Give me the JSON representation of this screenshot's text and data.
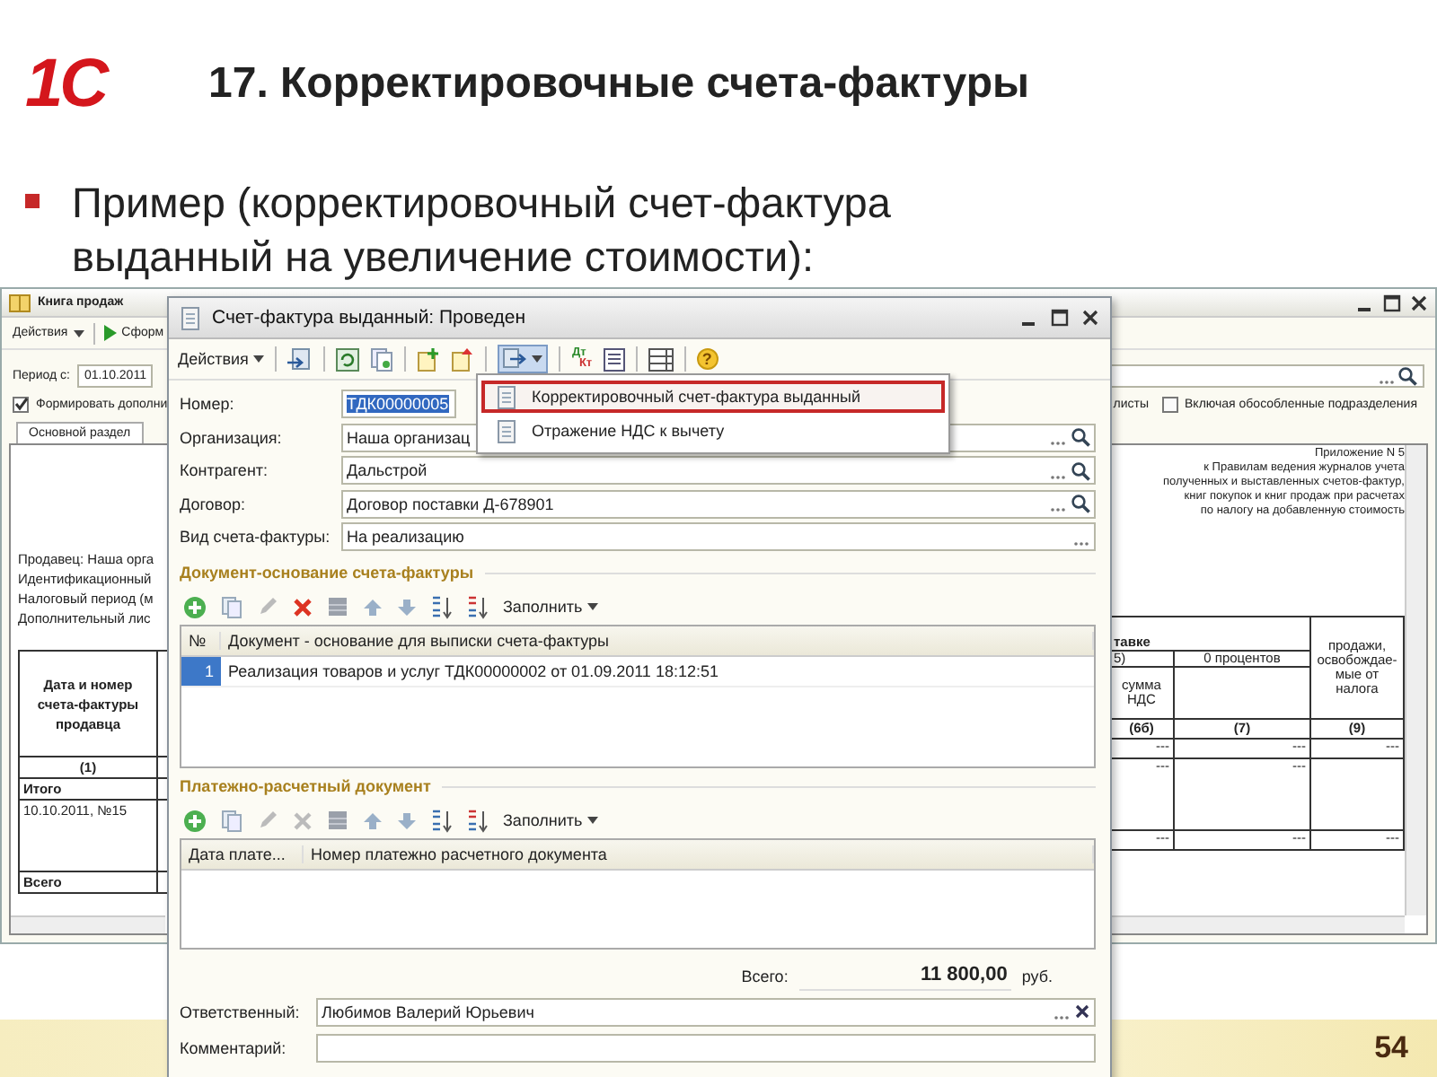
{
  "slide": {
    "logo": "1С",
    "title": "17. Корректировочные счета-фактуры",
    "bullet": "Пример (корректировочный счет-фактура выданный на увеличение стоимости):",
    "page_number": "54"
  },
  "book_window": {
    "title": "Книга продаж",
    "actions": "Действия",
    "generate": "Сформ",
    "period_label": "Период с:",
    "period_value": "01.10.2011",
    "options": [
      {
        "label": "Формировать дополни",
        "checked": true
      },
      {
        "label": "Включая обособленные подразделения",
        "checked": false
      }
    ],
    "sheets_label": "листы",
    "tabs": [
      {
        "label": "Основной раздел",
        "selected": true
      }
    ],
    "appendix_lines": [
      "Приложение N 5",
      "к Правилам ведения журналов учета",
      "полученных и выставленных счетов-фактур,",
      "книг покупок и книг продаж при расчетах",
      "по налогу на добавленную стоимость"
    ],
    "seller_lines": [
      "Продавец: Наша орга",
      "Идентификационный",
      "Налоговый период (м",
      "Дополнительный лис"
    ],
    "left_table": {
      "header": "Дата и номер счета-фактуры продавца",
      "number": "(1)",
      "rows": [
        "Итого",
        "10.10.2011, №15",
        "Всего"
      ]
    },
    "right_table": {
      "group_header": "тавке",
      "col_1_top": "5)",
      "col_2_top": "0 процентов",
      "col_1_sub": "сумма НДС",
      "col_3_header": "продажи, освобождае-мые от налога",
      "numbers": [
        "(6б)",
        "(7)",
        "(9)"
      ],
      "rows": [
        {
          "cells": [
            "---",
            "---",
            "---"
          ]
        },
        {
          "cells": [
            "---",
            "---"
          ]
        },
        {
          "cells": [
            "---",
            "---",
            "---"
          ]
        }
      ]
    }
  },
  "invoice_window": {
    "title": "Счет-фактура выданный: Проведен",
    "actions": "Действия",
    "ledger_marks": [
      "Дт",
      "Кт"
    ],
    "help": "?",
    "menu": [
      {
        "label": "Корректировочный счет-фактура выданный",
        "selected": true
      },
      {
        "label": "Отражение НДС к вычету",
        "selected": false
      }
    ],
    "fields": [
      {
        "label": "Номер:",
        "value": "ТДК00000005",
        "kind": "number",
        "selected": true
      },
      {
        "label": "Организация:",
        "value": "Наша организац",
        "kind": "lookup"
      },
      {
        "label": "Контрагент:",
        "value": "Дальстрой",
        "kind": "lookup"
      },
      {
        "label": "Договор:",
        "value": "Договор поставки Д-678901",
        "kind": "lookup"
      },
      {
        "label": "Вид счета-фактуры:",
        "value": "На реализацию",
        "kind": "select"
      }
    ],
    "sections": [
      {
        "title": "Документ-основание счета-фактуры",
        "fill": "Заполнить",
        "columns": [
          "№",
          "Документ - основание для выписки счета-фактуры"
        ],
        "rows": [
          {
            "cells": [
              "1",
              "Реализация товаров и услуг ТДК00000002 от 01.09.2011 18:12:51"
            ],
            "selected": true
          }
        ]
      },
      {
        "title": "Платежно-расчетный документ",
        "fill": "Заполнить",
        "columns": [
          "Дата плате...",
          "Номер платежно расчетного документа"
        ]
      }
    ],
    "total": {
      "label": "Всего:",
      "value": "11 800,00",
      "currency": "руб."
    },
    "bottom_fields": [
      {
        "label": "Ответственный:",
        "value": "Любимов Валерий Юрьевич",
        "kind": "clear"
      },
      {
        "label": "Комментарий:",
        "kind": "plain"
      }
    ]
  }
}
